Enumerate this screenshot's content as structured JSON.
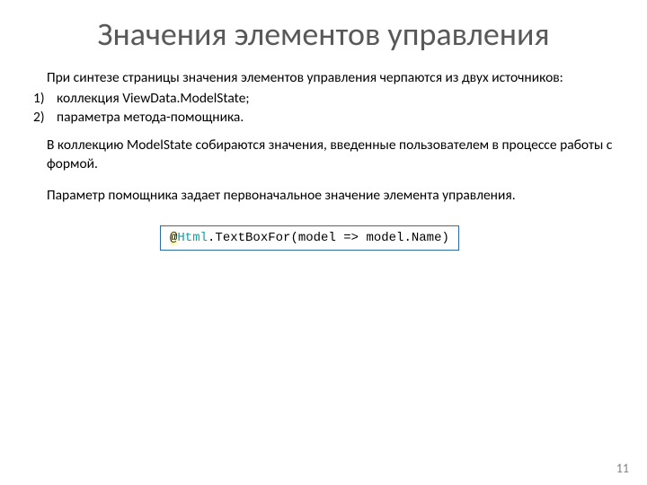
{
  "slide": {
    "title": "Значения элементов управления",
    "intro": "При синтезе страницы значения элементов управления черпаются из двух источников:",
    "list": {
      "item1_num": "1)",
      "item1": "коллекция ViewData.ModelState;",
      "item2_num": "2)",
      "item2": "параметра метода-помощника."
    },
    "para1": "В коллекцию ModelState собираются значения, введенные пользователем в процессе работы с формой.",
    "para2": "Параметр помощника задает первоначальное значение элемента управления.",
    "code": {
      "at": "@",
      "kw": "Html",
      "dot": ".",
      "method": "TextBoxFor",
      "args": "(model => model.Name)"
    },
    "page_number": "11"
  }
}
